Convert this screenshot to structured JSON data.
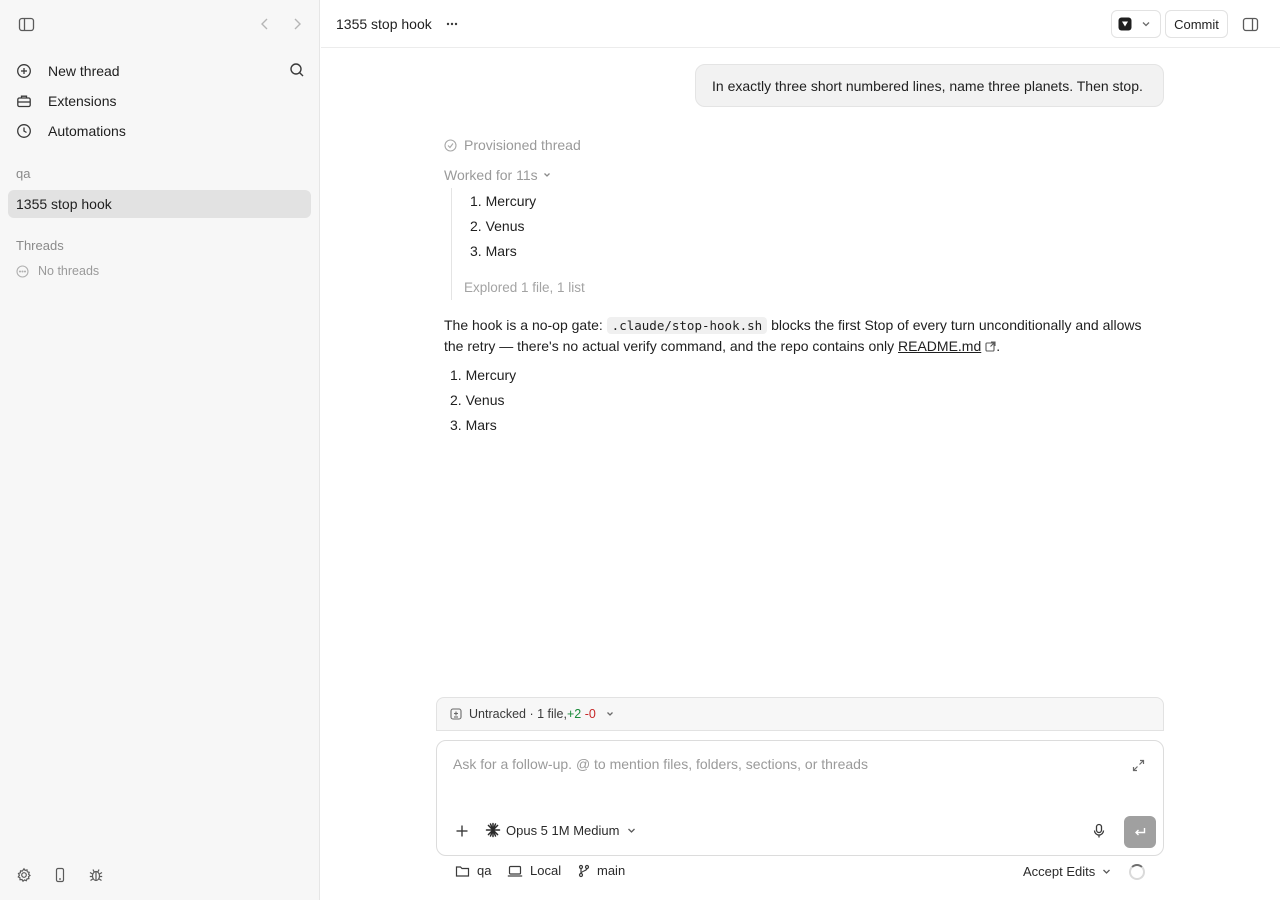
{
  "sidebar": {
    "nav": [
      {
        "label": "New thread",
        "icon": "plus-circle-icon"
      },
      {
        "label": "Extensions",
        "icon": "toolbox-icon"
      },
      {
        "label": "Automations",
        "icon": "clock-icon"
      }
    ],
    "project_section": "qa",
    "active_thread": "1355 stop hook",
    "threads_section": "Threads",
    "empty_threads": "No threads"
  },
  "header": {
    "thread_title": "1355 stop hook",
    "commit_label": "Commit"
  },
  "conversation": {
    "user_message": "In exactly three short numbered lines, name three planets. Then stop.",
    "provisioned": "Provisioned thread",
    "worked_for": "Worked for 11s",
    "worked_items": [
      "Mercury",
      "Venus",
      "Mars"
    ],
    "explored": "Explored 1 file, 1 list",
    "answer": {
      "pre_code": "The hook is a no-op gate: ",
      "code": ".claude/stop-hook.sh",
      "post_code": " blocks the first Stop of every turn unconditionally and allows the retry — there's no actual verify command, and the repo contains only ",
      "link": "README.md",
      "end": "."
    },
    "answer_items": [
      "Mercury",
      "Venus",
      "Mars"
    ]
  },
  "changes": {
    "label": "Untracked · 1 file, ",
    "added": "+2",
    "removed": "-0"
  },
  "composer": {
    "placeholder": "Ask for a follow-up. @ to mention files, folders, sections, or threads",
    "model": "Opus 5 1M Medium"
  },
  "footer": {
    "folder": "qa",
    "environment": "Local",
    "branch": "main",
    "mode": "Accept Edits"
  }
}
